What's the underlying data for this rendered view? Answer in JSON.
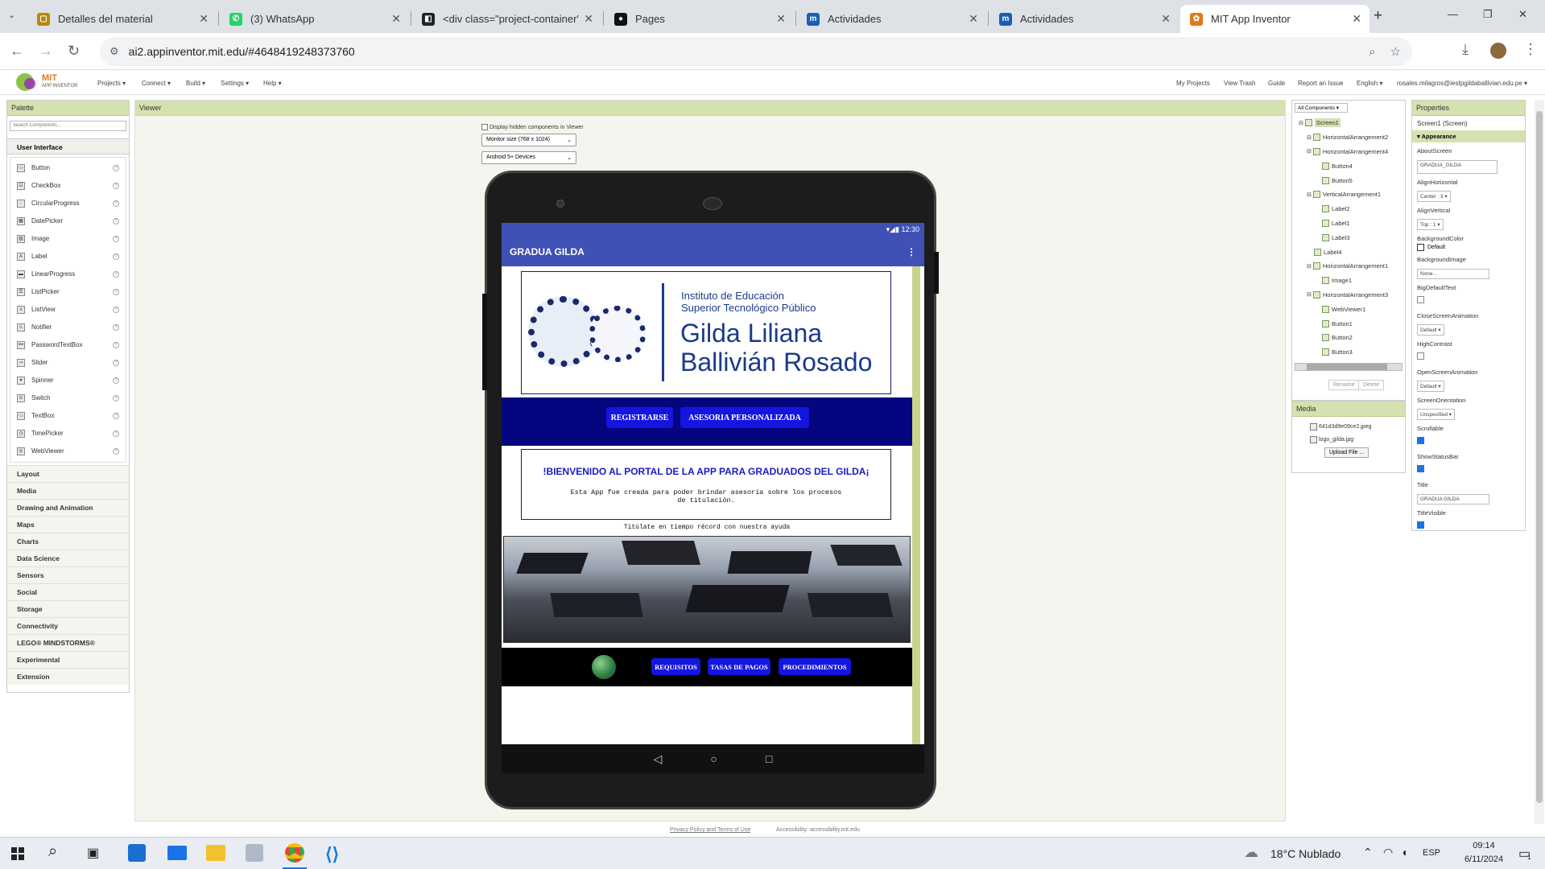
{
  "browser": {
    "tabs": [
      {
        "title": "Detalles del material",
        "favicon_color": "#b8860b",
        "favicon_text": "▢"
      },
      {
        "title": "(3) WhatsApp",
        "favicon_color": "#25d366",
        "favicon_text": "✆"
      },
      {
        "title": "<div class=\"project-container\"",
        "favicon_color": "#222222",
        "favicon_text": "◧"
      },
      {
        "title": "Pages",
        "favicon_color": "#111111",
        "favicon_text": "●"
      },
      {
        "title": "Actividades",
        "favicon_color": "#1a5fb4",
        "favicon_text": "m"
      },
      {
        "title": "Actividades",
        "favicon_color": "#1a5fb4",
        "favicon_text": "m"
      },
      {
        "title": "MIT App Inventor",
        "favicon_color": "#e07a1f",
        "favicon_text": "✿"
      }
    ],
    "url": "ai2.appinventor.mit.edu/#4648419248373760",
    "new_tab": "+",
    "window_controls": [
      "—",
      "❐",
      "✕"
    ]
  },
  "ai_header": {
    "logo_main": "MIT",
    "logo_sub": "APP INVENTOR",
    "menus": [
      "Projects ▾",
      "Connect ▾",
      "Build ▾",
      "Settings ▾",
      "Help ▾"
    ],
    "right_links": [
      "My Projects",
      "View Trash",
      "Guide",
      "Report an Issue",
      "English ▾",
      "rosales.milagros@iestpgildaballivian.edu.pe ▾"
    ]
  },
  "palette": {
    "title": "Palette",
    "search_placeholder": "Search Components...",
    "section": "User Interface",
    "items": [
      "Button",
      "CheckBox",
      "CircularProgress",
      "DatePicker",
      "Image",
      "Label",
      "LinearProgress",
      "ListPicker",
      "ListView",
      "Notifier",
      "PasswordTextBox",
      "Slider",
      "Spinner",
      "Switch",
      "TextBox",
      "TimePicker",
      "WebViewer"
    ],
    "categories": [
      "Layout",
      "Media",
      "Drawing and Animation",
      "Maps",
      "Charts",
      "Data Science",
      "Sensors",
      "Social",
      "Storage",
      "Connectivity",
      "LEGO® MINDSTORMS®",
      "Experimental",
      "Extension"
    ]
  },
  "viewer": {
    "title": "Viewer",
    "hidden_checkbox_label": "Display hidden components in Viewer",
    "size_select": "Monitor size (768 x 1024)",
    "device_select": "Android 5+ Devices"
  },
  "phone": {
    "status_time": "12:30",
    "app_title": "GRADUA GILDA",
    "logo_line1": "Instituto de Educación",
    "logo_line2": "Superior Tecnológico Público",
    "logo_name1": "Gilda Liliana",
    "logo_name2": "Ballivián Rosado",
    "btn_register": "REGISTRARSE",
    "btn_advice": "ASESORIA PERSONALIZADA",
    "welcome": "!BIENVENIDO AL PORTAL DE LA APP PARA GRADUADOS DEL GILDA¡",
    "desc": "Esta App fue creada para poder brindar asesoria sobre los procesos de titulación.",
    "tagline": "Titúlate en tiempo récord con nuestra ayuda",
    "btn_req": "REQUISITOS",
    "btn_fees": "TASAS DE PAGOS",
    "btn_proc": "PROCEDIMIENTOS"
  },
  "components": {
    "dropdown": "All Components ▾",
    "tree": [
      {
        "name": "Screen1",
        "level": 0
      },
      {
        "name": "HorizontalArrangement2",
        "level": 1
      },
      {
        "name": "HorizontalArrangement4",
        "level": 1
      },
      {
        "name": "Button4",
        "level": 2
      },
      {
        "name": "Button5",
        "level": 2
      },
      {
        "name": "VerticalArrangement1",
        "level": 1
      },
      {
        "name": "Label2",
        "level": 2
      },
      {
        "name": "Label1",
        "level": 2
      },
      {
        "name": "Label3",
        "level": 2
      },
      {
        "name": "Label4",
        "level": 1
      },
      {
        "name": "HorizontalArrangement1",
        "level": 1
      },
      {
        "name": "Image1",
        "level": 2
      },
      {
        "name": "HorizontalArrangement3",
        "level": 1
      },
      {
        "name": "WebViewer1",
        "level": 2
      },
      {
        "name": "Button1",
        "level": 2
      },
      {
        "name": "Button2",
        "level": 2
      },
      {
        "name": "Button3",
        "level": 2
      }
    ],
    "rename": "Rename",
    "delete": "Delete"
  },
  "media": {
    "title": "Media",
    "files": [
      "641d3d9e09ce2.jpeg",
      "logo_gilda.jpg"
    ],
    "upload": "Upload File ..."
  },
  "properties": {
    "title": "Properties",
    "component": "Screen1 (Screen)",
    "group": "Appearance",
    "about_label": "AboutScreen",
    "about_value": "GRADUA_GILDA",
    "align_h_label": "AlignHorizontal",
    "align_h_value": "Center : 3 ▾",
    "align_v_label": "AlignVertical",
    "align_v_value": "Top : 1 ▾",
    "bgcolor_label": "BackgroundColor",
    "bgcolor_value": "Default",
    "bgimage_label": "BackgroundImage",
    "bgimage_value": "None...",
    "bigtext_label": "BigDefaultText",
    "close_anim_label": "CloseScreenAnimation",
    "close_anim_value": "Default ▾",
    "contrast_label": "HighContrast",
    "open_anim_label": "OpenScreenAnimation",
    "open_anim_value": "Default ▾",
    "orient_label": "ScreenOrientation",
    "orient_value": "Unspecified ▾",
    "scroll_label": "Scrollable",
    "statusbar_label": "ShowStatusBar",
    "title_label": "Title",
    "title_value": "GRADUA GILDA",
    "titlevis_label": "TitleVisible"
  },
  "footer": {
    "privacy": "Privacy Policy and Terms of Use",
    "access": "Accessibility: accessibility.mit.edu"
  },
  "taskbar": {
    "weather": "18°C  Nublado",
    "lang": "ESP",
    "time": "09:14",
    "date": "6/11/2024",
    "notif_count": "1"
  }
}
